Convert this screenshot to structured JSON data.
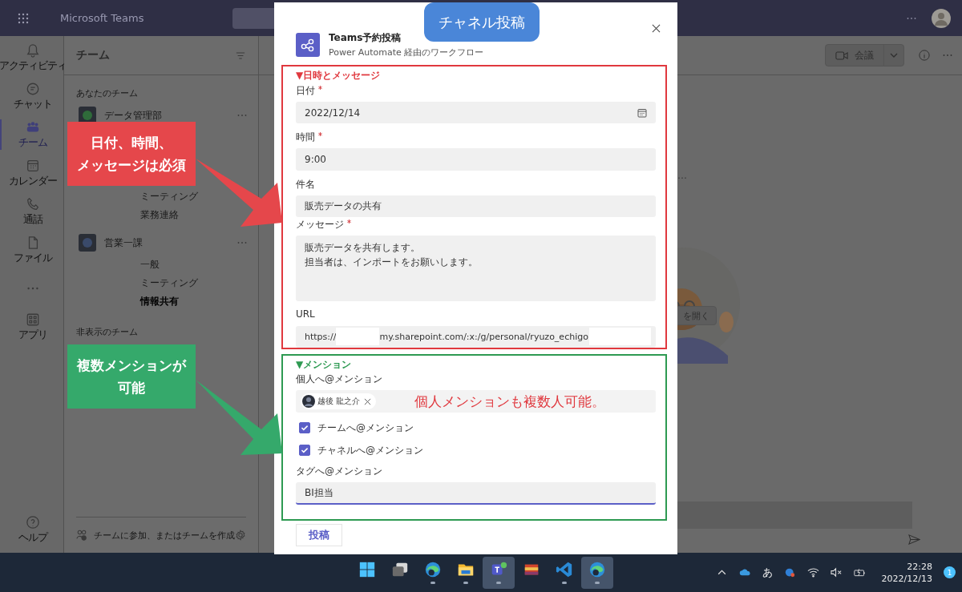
{
  "app": {
    "title": "Microsoft Teams"
  },
  "rail": [
    {
      "kind": "activity",
      "label": "アクティビティ",
      "selected": false
    },
    {
      "kind": "chat",
      "label": "チャット",
      "selected": false
    },
    {
      "kind": "teams",
      "label": "チーム",
      "selected": true
    },
    {
      "kind": "calendar",
      "label": "カレンダー",
      "selected": false
    },
    {
      "kind": "calls",
      "label": "通話",
      "selected": false
    },
    {
      "kind": "files",
      "label": "ファイル",
      "selected": false
    },
    {
      "kind": "more",
      "selected": false
    },
    {
      "kind": "apps",
      "label": "アプリ",
      "selected": false
    }
  ],
  "help": {
    "label": "ヘルプ"
  },
  "teams_panel": {
    "title": "チーム",
    "section": "あなたのチーム",
    "teams": [
      {
        "name": "データ管理部",
        "channels": [
          {
            "name": "ミーティング",
            "unread": false
          },
          {
            "name": "業務連絡",
            "unread": false
          }
        ]
      },
      {
        "name": "営業一課",
        "channels": [
          {
            "name": "一般",
            "unread": false
          },
          {
            "name": "ミーティング",
            "unread": false
          },
          {
            "name": "情報共有",
            "unread": true
          }
        ]
      }
    ],
    "hidden_section": "非表示のチーム",
    "footer": "チームに参加、またはチームを作成"
  },
  "main": {
    "meeting_button": "会議",
    "ellipsis": "…",
    "open_button": "を開く"
  },
  "dialog": {
    "title": "Teams予約投稿",
    "subtitle": "Power Automate 経由のワークフロー",
    "banner": "チャネル投稿",
    "sections": [
      {
        "heading": "▼日時とメッセージ",
        "color": "#e0383e",
        "fields": [
          {
            "kind": "date",
            "label": "日付",
            "required": true,
            "value": "2022/12/14"
          },
          {
            "kind": "text",
            "label": "時間",
            "required": true,
            "value": "9:00"
          },
          {
            "kind": "text",
            "label": "件名",
            "required": false,
            "value": "販売データの共有"
          },
          {
            "kind": "textarea",
            "label": "メッセージ",
            "required": true,
            "lines": [
              "販売データを共有します。",
              "担当者は、インポートをお願いします。"
            ]
          },
          {
            "kind": "url",
            "label": "URL",
            "required": false,
            "value_parts": [
              "https://",
              "my.sharepoint.com/:x:/g/personal/ryuzo_echigo"
            ]
          }
        ]
      },
      {
        "heading": "▼メンション",
        "color": "#2e9a52",
        "fields": [
          {
            "kind": "people",
            "label": "個人へ@メンション",
            "required": false,
            "chips": [
              "越後 龍之介"
            ],
            "note": "個人メンションも複数人可能。"
          },
          {
            "kind": "checkbox",
            "label": "チームへ@メンション",
            "checked": true
          },
          {
            "kind": "checkbox",
            "label": "チャネルへ@メンション",
            "checked": true
          },
          {
            "kind": "text",
            "label": "タグへ@メンション",
            "required": false,
            "value": "BI担当",
            "focused": true
          }
        ]
      }
    ],
    "submit": "投稿"
  },
  "callouts": [
    {
      "lines": [
        "日付、時間、",
        "メッセージは必須"
      ],
      "color": "#e5474b"
    },
    {
      "lines": [
        "複数メンションが",
        "可能"
      ],
      "color": "#35a96b"
    }
  ],
  "taskbar": {
    "apps": [
      {
        "kind": "start",
        "running": false,
        "active": false
      },
      {
        "kind": "taskview",
        "running": false,
        "active": false
      },
      {
        "kind": "edge",
        "running": true,
        "active": false
      },
      {
        "kind": "folder",
        "running": true,
        "active": false
      },
      {
        "kind": "teams",
        "running": true,
        "active": true
      },
      {
        "kind": "archive",
        "running": false,
        "active": false
      },
      {
        "kind": "code",
        "running": true,
        "active": false
      },
      {
        "kind": "edge",
        "running": true,
        "active": true
      }
    ],
    "ime": "あ",
    "time": "22:28",
    "date": "2022/12/13",
    "badge": "1"
  }
}
